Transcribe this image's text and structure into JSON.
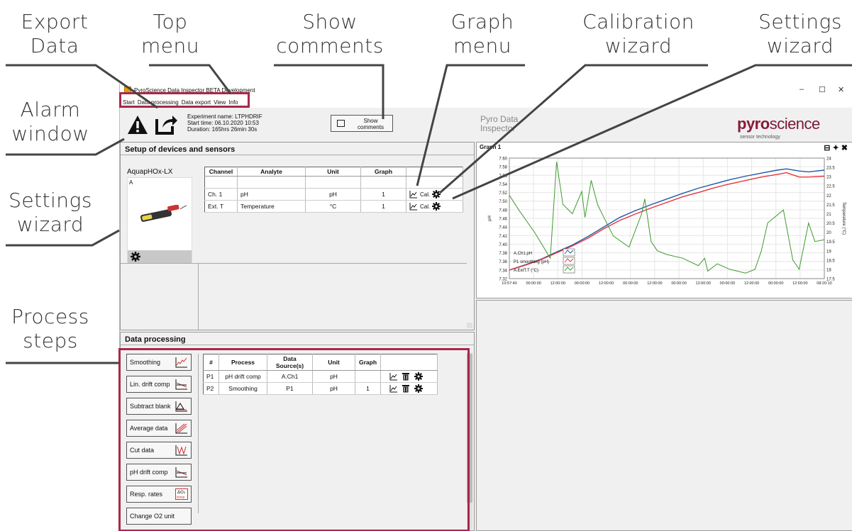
{
  "callouts": {
    "export_data": [
      "Export",
      "Data"
    ],
    "top_menu": [
      "Top",
      "menu"
    ],
    "show_comments": [
      "Show",
      "comments"
    ],
    "graph_menu": [
      "Graph",
      "menu"
    ],
    "calibration_wizard": [
      "Calibration",
      "wizard"
    ],
    "settings_wizard_top": [
      "Settings",
      "wizard"
    ],
    "alarm_window": [
      "Alarm",
      "window"
    ],
    "settings_wizard_left": [
      "Settings",
      "wizard"
    ],
    "process_steps": [
      "Process",
      "steps"
    ]
  },
  "window": {
    "title": "PyroScience Data Inspector BETA Development",
    "controls": [
      "–",
      "☐",
      "✕"
    ]
  },
  "menu": [
    "Start",
    "Data processing",
    "Data export",
    "View",
    "Info"
  ],
  "experiment": {
    "name": "Experiment name: LTPHDRIF",
    "start": "Start time: 06.10.2020 10:53",
    "duration": "Duration: 165hrs 26min 30s"
  },
  "show_comments_label": "Show comments",
  "brand": {
    "app_name": "Pyro Data Inspector",
    "logo_pyro": "pyro",
    "logo_science": "science",
    "tagline": "sensor technology"
  },
  "setup": {
    "title": "Setup of devices and sensors",
    "device_name": "AquapHOx-LX",
    "device_channel": "A",
    "headers": [
      "Channel",
      "Analyte",
      "Unit",
      "Graph"
    ],
    "rows": [
      {
        "channel": "Ch. 1",
        "analyte": "pH",
        "unit": "pH",
        "graph": "1",
        "cal": "Cal."
      },
      {
        "channel": "Ext. T",
        "analyte": "Temperature",
        "unit": "°C",
        "graph": "1",
        "cal": "Cal."
      }
    ]
  },
  "processing": {
    "title": "Data processing",
    "steps": [
      "Smoothing",
      "Lin. drift comp",
      "Subtract blank",
      "Average data",
      "Cut data",
      "pH drift comp",
      "Resp. rates",
      "Change O2 unit"
    ],
    "headers": [
      "#",
      "Process",
      "Data Source(s)",
      "Unit",
      "Graph"
    ],
    "rows": [
      {
        "id": "P1",
        "process": "pH drift comp",
        "source": "A.Ch1",
        "unit": "pH",
        "graph": ""
      },
      {
        "id": "P2",
        "process": "Smoothing",
        "source": "P1",
        "unit": "pH",
        "graph": "1"
      }
    ]
  },
  "graph": {
    "title": "Graph 1",
    "icons": [
      "graph-menu-icon",
      "pin-icon",
      "close-icon"
    ]
  },
  "colors": {
    "accent": "#a8284a",
    "series_blue": "#1f5aa8",
    "series_red": "#e8343c",
    "series_green": "#3f9a2e"
  },
  "chart_data": {
    "type": "line",
    "title": "",
    "xlabel": "",
    "ylabel": "pH",
    "y2label": "Temperature (°C)",
    "x_ticks": [
      "10:57:40",
      "00:00:00",
      "12:00:00",
      "00:00:00",
      "12:00:00",
      "00:00:00",
      "12:00:00",
      "00:00:00",
      "12:00:00",
      "00:00:00",
      "12:00:00",
      "00:00:00",
      "12:00:00",
      "08:20:10"
    ],
    "ylim": [
      7.32,
      7.6
    ],
    "y_ticks": [
      7.32,
      7.34,
      7.36,
      7.38,
      7.4,
      7.42,
      7.44,
      7.46,
      7.48,
      7.5,
      7.52,
      7.54,
      7.56,
      7.58,
      7.6
    ],
    "y2lim": [
      17.5,
      24
    ],
    "y2_ticks": [
      17.5,
      18,
      18.5,
      19,
      19.5,
      20,
      20.5,
      21,
      21.5,
      22,
      22.5,
      23,
      23.5,
      24
    ],
    "grid": true,
    "legend_position": "bottom-left",
    "series": [
      {
        "name": "A.Ch1.pH",
        "axis": "left",
        "x": [
          0,
          5,
          10,
          15,
          20,
          25,
          30,
          35,
          40,
          45,
          50,
          55,
          60,
          65,
          70,
          75,
          80,
          85,
          88,
          92,
          95,
          100
        ],
        "values": [
          7.34,
          7.352,
          7.365,
          7.382,
          7.398,
          7.418,
          7.44,
          7.462,
          7.478,
          7.492,
          7.505,
          7.518,
          7.53,
          7.54,
          7.55,
          7.558,
          7.565,
          7.572,
          7.575,
          7.57,
          7.568,
          7.572
        ]
      },
      {
        "name": "P1 smoothing (pH)",
        "axis": "left",
        "x": [
          0,
          5,
          10,
          15,
          20,
          25,
          30,
          35,
          40,
          45,
          50,
          55,
          60,
          65,
          70,
          75,
          80,
          85,
          88,
          92,
          95,
          100
        ],
        "values": [
          7.34,
          7.351,
          7.364,
          7.38,
          7.396,
          7.414,
          7.436,
          7.455,
          7.47,
          7.484,
          7.497,
          7.51,
          7.52,
          7.531,
          7.54,
          7.548,
          7.556,
          7.562,
          7.566,
          7.556,
          7.556,
          7.558
        ]
      },
      {
        "name": "A.ExtT.T (°C)",
        "axis": "right",
        "x": [
          0,
          3,
          8,
          13,
          15,
          17,
          20,
          23,
          24,
          26,
          28,
          30,
          33,
          38,
          42,
          43,
          45,
          47,
          50,
          55,
          60,
          62,
          63,
          66,
          70,
          75,
          78,
          80,
          82,
          87,
          90,
          92,
          95,
          97,
          100
        ],
        "values": [
          22.0,
          21.2,
          20.0,
          18.6,
          23.8,
          21.5,
          21.0,
          22.2,
          20.8,
          22.8,
          21.5,
          20.8,
          19.8,
          19.2,
          21.0,
          21.8,
          19.5,
          19.0,
          18.8,
          18.6,
          18.2,
          18.6,
          17.9,
          18.3,
          18.0,
          17.8,
          18.0,
          19.0,
          20.5,
          21.2,
          18.5,
          18.0,
          20.5,
          19.5,
          19.6
        ]
      }
    ]
  }
}
